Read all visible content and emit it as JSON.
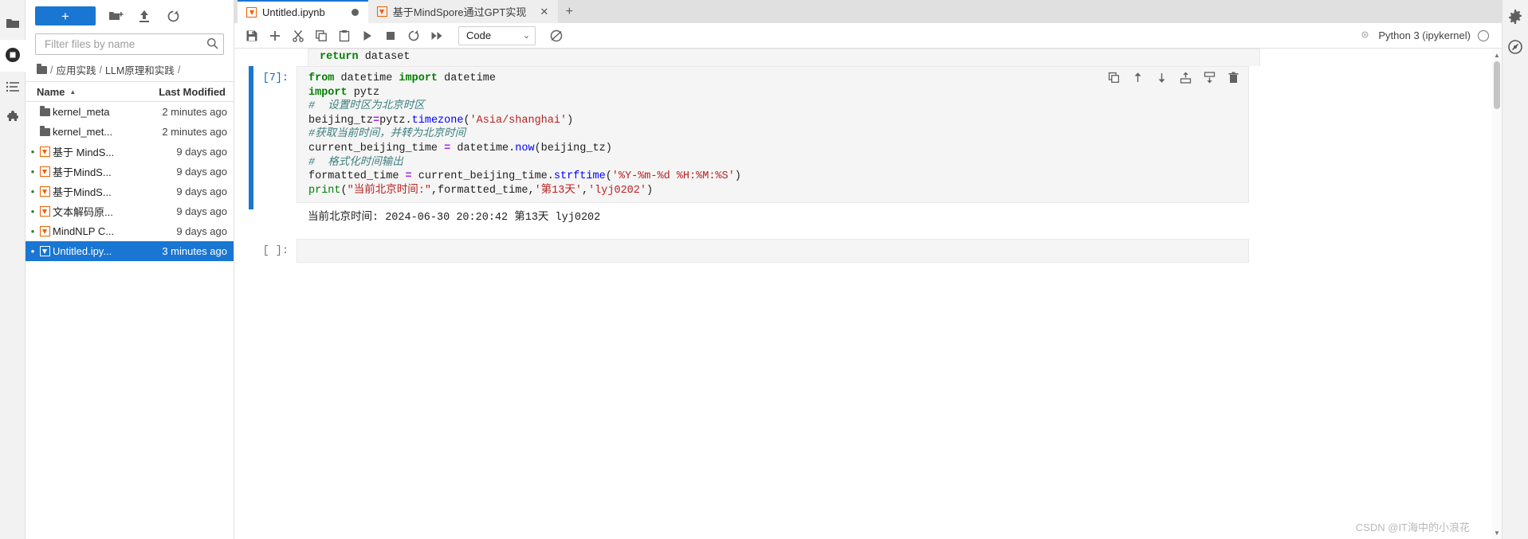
{
  "activity_bar": {
    "items": [
      {
        "name": "file-browser",
        "icon": "folder-icon",
        "active": false
      },
      {
        "name": "running-terminals",
        "icon": "stop-circle-icon",
        "active": true
      },
      {
        "name": "table-of-contents",
        "icon": "list-icon",
        "active": false
      },
      {
        "name": "extension-manager",
        "icon": "puzzle-icon",
        "active": false
      }
    ]
  },
  "file_browser": {
    "new_launcher_label": "+",
    "toolbar_icons": [
      "new-folder-icon",
      "upload-icon",
      "refresh-icon"
    ],
    "filter": {
      "value": "",
      "placeholder": "Filter files by name",
      "icon": "search-icon"
    },
    "breadcrumb": {
      "root_icon": "folder-icon",
      "parts": [
        "应用实践",
        "LLM原理和实践"
      ],
      "separator": "/"
    },
    "columns": {
      "name": "Name",
      "last_modified": "Last Modified",
      "sort_caret": "▲"
    },
    "files": [
      {
        "name": "kernel_meta",
        "modified": "2 minutes ago",
        "type": "folder",
        "running": false,
        "selected": false
      },
      {
        "name": "kernel_met...",
        "modified": "2 minutes ago",
        "type": "folder",
        "running": false,
        "selected": false
      },
      {
        "name": "基于 MindS...",
        "modified": "9 days ago",
        "type": "notebook",
        "running": true,
        "selected": false
      },
      {
        "name": "基于MindS...",
        "modified": "9 days ago",
        "type": "notebook",
        "running": true,
        "selected": false
      },
      {
        "name": "基于MindS...",
        "modified": "9 days ago",
        "type": "notebook",
        "running": true,
        "selected": false
      },
      {
        "name": "文本解码原...",
        "modified": "9 days ago",
        "type": "notebook",
        "running": true,
        "selected": false
      },
      {
        "name": "MindNLP C...",
        "modified": "9 days ago",
        "type": "notebook",
        "running": true,
        "selected": false
      },
      {
        "name": "Untitled.ipy...",
        "modified": "3 minutes ago",
        "type": "notebook",
        "running": true,
        "selected": true
      }
    ]
  },
  "tabs": [
    {
      "label": "Untitled.ipynb",
      "icon": "notebook-icon",
      "active": true,
      "dirty": true,
      "closable": false
    },
    {
      "label": "基于MindSpore通过GPT实现",
      "icon": "notebook-icon",
      "active": false,
      "dirty": false,
      "closable": true
    }
  ],
  "tab_add_label": "+",
  "notebook_toolbar": {
    "buttons": [
      {
        "name": "save-button",
        "icon": "save-icon"
      },
      {
        "name": "insert-cell-button",
        "icon": "plus-icon"
      },
      {
        "name": "cut-cell-button",
        "icon": "scissors-icon"
      },
      {
        "name": "copy-cell-button",
        "icon": "copy-icon"
      },
      {
        "name": "paste-cell-button",
        "icon": "clipboard-icon"
      },
      {
        "name": "run-cell-button",
        "icon": "play-icon"
      },
      {
        "name": "interrupt-kernel-button",
        "icon": "stop-icon"
      },
      {
        "name": "restart-kernel-button",
        "icon": "refresh-icon"
      },
      {
        "name": "restart-run-all-button",
        "icon": "fast-forward-icon"
      }
    ],
    "cell_type": "Code",
    "cell_type_caret": "⌄",
    "extra_icon": "loop-icon",
    "kernel_status_icon": "kernel-busy-icon",
    "kernel_name": "Python 3 (ipykernel)"
  },
  "notebook": {
    "partial_cell_text": "return dataset",
    "cells": [
      {
        "prompt": "[7]:",
        "code_lines": [
          [
            {
              "t": "from",
              "c": "kw"
            },
            {
              "t": " datetime ",
              "c": "txt"
            },
            {
              "t": "import",
              "c": "kw"
            },
            {
              "t": " datetime",
              "c": "txt"
            }
          ],
          [
            {
              "t": "import",
              "c": "kw"
            },
            {
              "t": " pytz",
              "c": "txt"
            }
          ],
          [
            {
              "t": "#  设置时区为北京时区",
              "c": "cm"
            }
          ],
          [
            {
              "t": "beijing_tz",
              "c": "txt"
            },
            {
              "t": "=",
              "c": "op"
            },
            {
              "t": "pytz.",
              "c": "txt"
            },
            {
              "t": "timezone",
              "c": "fn"
            },
            {
              "t": "(",
              "c": "txt"
            },
            {
              "t": "'Asia/shanghai'",
              "c": "st"
            },
            {
              "t": ")",
              "c": "txt"
            }
          ],
          [
            {
              "t": "#获取当前时间，并转为北京时间",
              "c": "cm"
            }
          ],
          [
            {
              "t": "current_beijing_time ",
              "c": "txt"
            },
            {
              "t": "=",
              "c": "op"
            },
            {
              "t": " datetime.",
              "c": "txt"
            },
            {
              "t": "now",
              "c": "fn"
            },
            {
              "t": "(beijing_tz)",
              "c": "txt"
            }
          ],
          [
            {
              "t": "#  格式化时间输出",
              "c": "cm"
            }
          ],
          [
            {
              "t": "formatted_time ",
              "c": "txt"
            },
            {
              "t": "=",
              "c": "op"
            },
            {
              "t": " current_beijing_time.",
              "c": "txt"
            },
            {
              "t": "strftime",
              "c": "fn"
            },
            {
              "t": "(",
              "c": "txt"
            },
            {
              "t": "'%Y-%m-%d %H:%M:%S'",
              "c": "st"
            },
            {
              "t": ")",
              "c": "txt"
            }
          ],
          [
            {
              "t": "print",
              "c": "bi"
            },
            {
              "t": "(",
              "c": "txt"
            },
            {
              "t": "\"当前北京时间:\"",
              "c": "st"
            },
            {
              "t": ",formatted_time,",
              "c": "txt"
            },
            {
              "t": "'第13天'",
              "c": "st"
            },
            {
              "t": ",",
              "c": "txt"
            },
            {
              "t": "'lyj0202'",
              "c": "st"
            },
            {
              "t": ")",
              "c": "txt"
            }
          ]
        ],
        "output": "当前北京时间: 2024-06-30 20:20:42 第13天 lyj0202",
        "toolbar_icons": [
          {
            "name": "duplicate-cell-icon",
            "glyph": "duplicate"
          },
          {
            "name": "move-cell-up-icon",
            "glyph": "arrow-up"
          },
          {
            "name": "move-cell-down-icon",
            "glyph": "arrow-down"
          },
          {
            "name": "insert-cell-above-icon",
            "glyph": "insert-above"
          },
          {
            "name": "insert-cell-below-icon",
            "glyph": "insert-below"
          },
          {
            "name": "delete-cell-icon",
            "glyph": "trash"
          }
        ]
      },
      {
        "prompt": "[ ]:",
        "code_lines": [],
        "output": "",
        "toolbar_icons": []
      }
    ]
  },
  "right_rail": {
    "icons": [
      "settings-gear-icon",
      "debugger-icon"
    ]
  },
  "watermark": "CSDN @IT海中的小浪花",
  "colors": {
    "accent": "#1976d2",
    "notebook_orange": "#ee6002",
    "keyword_green": "#008000",
    "comment_teal": "#408080",
    "string_red": "#ba2121",
    "function_blue": "#0000ff",
    "operator_purple": "#aa22ff",
    "running_dot_green": "#2e7d32"
  }
}
